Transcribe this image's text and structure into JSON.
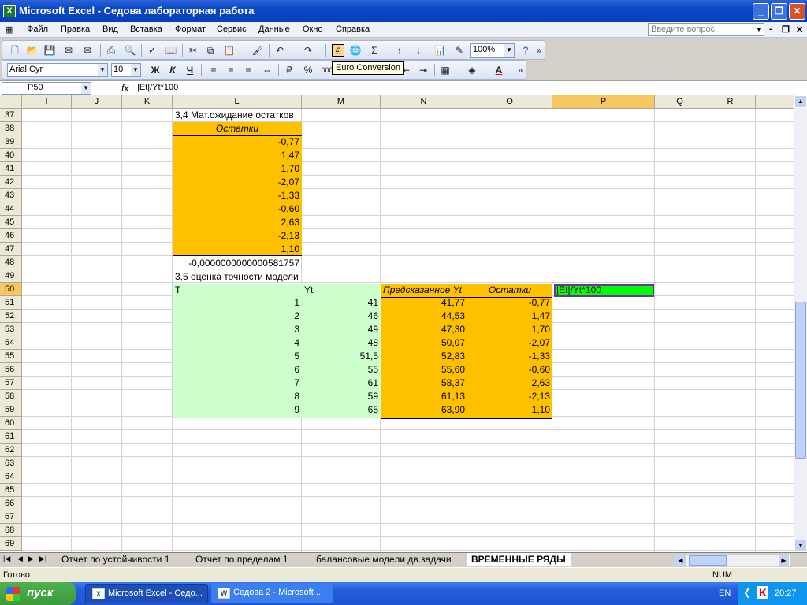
{
  "window": {
    "title": "Microsoft Excel - Седова лабораторная работа"
  },
  "menu": [
    "Файл",
    "Правка",
    "Вид",
    "Вставка",
    "Формат",
    "Сервис",
    "Данные",
    "Окно",
    "Справка"
  ],
  "ask_placeholder": "Введите вопрос",
  "toolbar": {
    "zoom": "100%",
    "font": "Arial Cyr",
    "size": "10",
    "bold": "Ж",
    "italic": "К",
    "underline": "Ч",
    "tooltip": "Euro Conversion"
  },
  "formula": {
    "cell": "P50",
    "fx": "fx",
    "value": "|Et|/Yt*100"
  },
  "columns": [
    "I",
    "J",
    "K",
    "L",
    "M",
    "N",
    "O",
    "P",
    "Q",
    "R"
  ],
  "rows": [
    "37",
    "38",
    "39",
    "40",
    "41",
    "42",
    "43",
    "44",
    "45",
    "46",
    "47",
    "48",
    "49",
    "50",
    "51",
    "52",
    "53",
    "54",
    "55",
    "56",
    "57",
    "58",
    "59",
    "60",
    "61",
    "62",
    "63",
    "64",
    "65",
    "66",
    "67",
    "68",
    "69"
  ],
  "cells": {
    "L37": "3,4 Мат.ожидание остатков",
    "L38": "Остатки",
    "residuals_1": [
      "-0,77",
      "1,47",
      "1,70",
      "-2,07",
      "-1,33",
      "-0,60",
      "2,63",
      "-2,13",
      "1,10"
    ],
    "L48": "-0,0000000000000581757",
    "L49": "3,5 оценка точности модели",
    "L50": "T",
    "M50": "Yt",
    "N50": "Предсказанное Yt",
    "O50": "Остатки",
    "P50": "|Et|/Yt*100",
    "table": {
      "T": [
        "1",
        "2",
        "3",
        "4",
        "5",
        "6",
        "7",
        "8",
        "9"
      ],
      "Yt": [
        "41",
        "46",
        "49",
        "48",
        "51,5",
        "55",
        "61",
        "59",
        "65"
      ],
      "Pred": [
        "41,77",
        "44,53",
        "47,30",
        "50,07",
        "52,83",
        "55,60",
        "58,37",
        "61,13",
        "63,90"
      ],
      "Res": [
        "-0,77",
        "1,47",
        "1,70",
        "-2,07",
        "-1,33",
        "-0,60",
        "2,63",
        "-2,13",
        "1,10"
      ]
    }
  },
  "sheets": [
    "Отчет по устойчивости 1",
    "Отчет по пределам 1",
    "балансовые модели дв.задачи",
    "ВРЕМЕННЫЕ РЯДЫ"
  ],
  "status": {
    "ready": "Готово",
    "num": "NUM"
  },
  "taskbar": {
    "start": "пуск",
    "tasks": [
      "Microsoft Excel - Седо...",
      "Седова 2 - Microsoft ..."
    ],
    "lang": "EN",
    "clock": "20:27"
  },
  "colors": {
    "orange": "#ffc000",
    "lightgreen": "#ccffcc",
    "brightgreen": "#00ff00",
    "selection": "#f8c860"
  }
}
